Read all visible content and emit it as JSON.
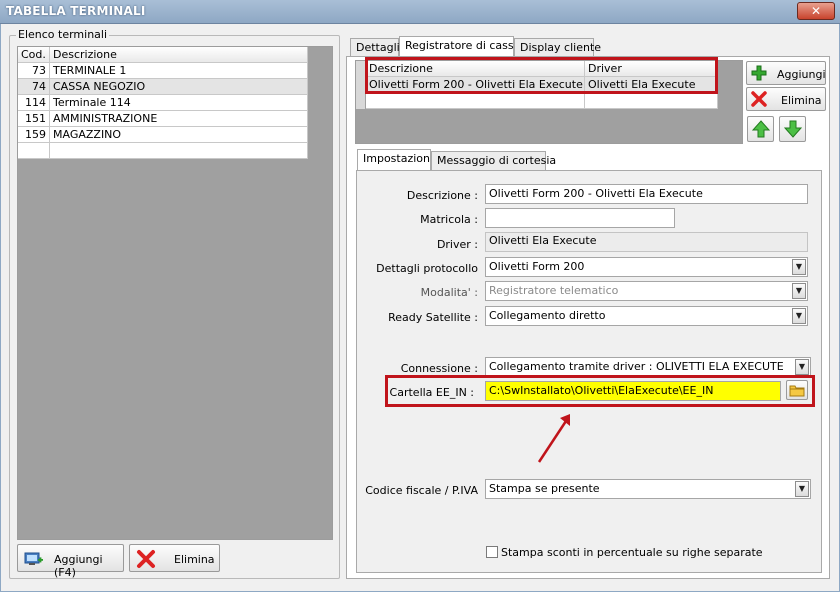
{
  "window": {
    "title": "TABELLA TERMINALI",
    "close_glyph": "✕"
  },
  "left_panel": {
    "group_label": "Elenco terminali",
    "columns": [
      "Cod.",
      "Descrizione"
    ],
    "rows": [
      {
        "code": "73",
        "description": "TERMINALE 1"
      },
      {
        "code": "74",
        "description": "CASSA NEGOZIO"
      },
      {
        "code": "114",
        "description": "Terminale 114"
      },
      {
        "code": "151",
        "description": "AMMINISTRAZIONE"
      },
      {
        "code": "159",
        "description": "MAGAZZINO"
      }
    ],
    "add_button_label": "Aggiungi (F4)",
    "delete_button_label": "Elimina"
  },
  "main_tabs": [
    "Dettagli",
    "Registratore di cassa",
    "Display cliente"
  ],
  "registers_grid": {
    "columns": [
      "Descrizione",
      "Driver"
    ],
    "rows": [
      {
        "description": "Olivetti Form 200 - Olivetti Ela Execute",
        "driver": "Olivetti Ela Execute"
      }
    ]
  },
  "side_buttons": {
    "add": "Aggiungi",
    "delete": "Elimina"
  },
  "sub_tabs": [
    "Impostazioni",
    "Messaggio di cortesia"
  ],
  "form": {
    "descrizione": {
      "label": "Descrizione :",
      "value": "Olivetti Form 200 - Olivetti Ela Execute"
    },
    "matricola": {
      "label": "Matricola :",
      "value": ""
    },
    "driver": {
      "label": "Driver :",
      "value": "Olivetti Ela Execute"
    },
    "dettagli_protocollo": {
      "label": "Dettagli protocollo",
      "value": "Olivetti Form 200"
    },
    "modalita": {
      "label": "Modalita' :",
      "value": "Registratore telematico"
    },
    "ready_satellite": {
      "label": "Ready Satellite :",
      "value": "Collegamento diretto"
    },
    "connessione": {
      "label": "Connessione :",
      "value": "Collegamento tramite driver : OLIVETTI ELA EXECUTE"
    },
    "cartella": {
      "label": "Cartella EE_IN :",
      "value": "C:\\SwInstallato\\Olivetti\\ElaExecute\\EE_IN"
    },
    "codice_fiscale": {
      "label": "Codice fiscale / P.IVA",
      "value": "Stampa se presente"
    },
    "stampa_sconti": {
      "label": "Stampa sconti in percentuale su righe separate",
      "checked": false
    }
  },
  "colors": {
    "highlight_red": "#c0141b",
    "field_yellow": "#ffff00",
    "grid_gray": "#a0a0a0"
  },
  "icons": {
    "add": "green-plus-icon",
    "delete": "red-x-icon",
    "up": "arrow-up-icon",
    "down": "arrow-down-icon",
    "folder": "folder-icon",
    "add_terminal": "add-terminal-icon"
  }
}
